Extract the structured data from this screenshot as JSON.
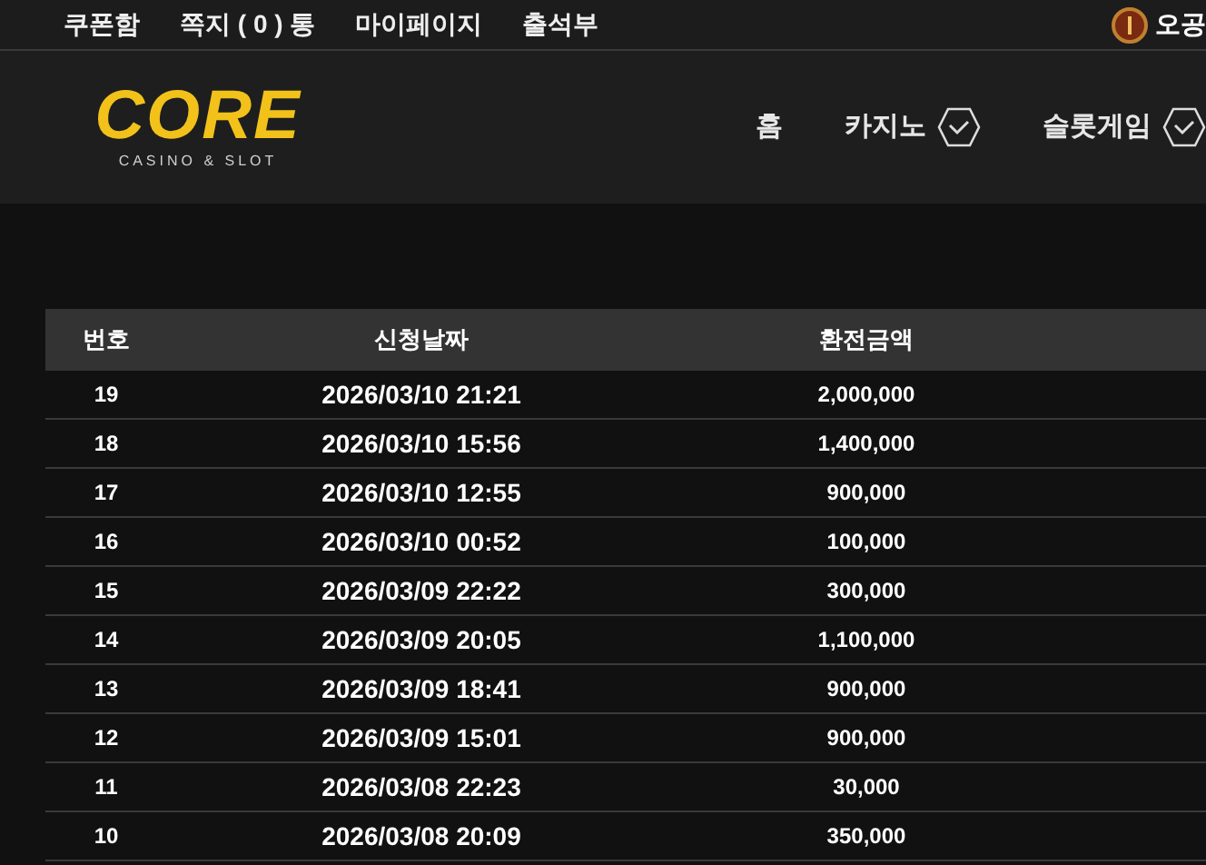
{
  "top_links": [
    "쿠폰함",
    "쪽지 ( 0 ) 통",
    "마이페이지",
    "출석부"
  ],
  "user": {
    "name": "오공"
  },
  "logo": {
    "title": "CORE",
    "subtitle": "CASINO & SLOT"
  },
  "nav": [
    {
      "label": "홈",
      "dropdown": false
    },
    {
      "label": "카지노",
      "dropdown": true
    },
    {
      "label": "슬롯게임",
      "dropdown": true
    }
  ],
  "table": {
    "columns": [
      "번호",
      "신청날짜",
      "환전금액"
    ],
    "rows": [
      [
        "19",
        "2026/03/10 21:21",
        "2,000,000"
      ],
      [
        "18",
        "2026/03/10 15:56",
        "1,400,000"
      ],
      [
        "17",
        "2026/03/10 12:55",
        "900,000"
      ],
      [
        "16",
        "2026/03/10 00:52",
        "100,000"
      ],
      [
        "15",
        "2026/03/09 22:22",
        "300,000"
      ],
      [
        "14",
        "2026/03/09 20:05",
        "1,100,000"
      ],
      [
        "13",
        "2026/03/09 18:41",
        "900,000"
      ],
      [
        "12",
        "2026/03/09 15:01",
        "900,000"
      ],
      [
        "11",
        "2026/03/08 22:23",
        "30,000"
      ],
      [
        "10",
        "2026/03/08 20:09",
        "350,000"
      ]
    ]
  }
}
